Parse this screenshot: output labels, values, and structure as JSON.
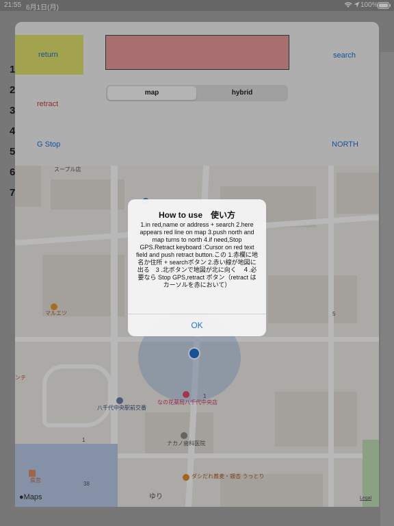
{
  "status": {
    "time": "21:55",
    "date": "6月1日(月)",
    "battery": "100%"
  },
  "background_list": {
    "rows": [
      "1",
      "2",
      "3",
      "4",
      "5",
      "6",
      "7"
    ]
  },
  "toolbar": {
    "return_label": "return",
    "search_label": "search",
    "retract_label": "retract",
    "gstop_label": "G Stop",
    "north_label": "NORTH",
    "search_field_value": "",
    "segments": [
      "map",
      "hybrid"
    ],
    "selected_segment": "map"
  },
  "map": {
    "pois": {
      "maruetsu": "マルエツ",
      "station_koban": "八千代中央駅前交番",
      "pharmacy": "なの花薬局八千代中央店",
      "dental": "ナカノ歯科医院",
      "restaurant": "ダシだれ蕎麦・銀杏 うっとり",
      "top_label": "スープル店",
      "left_label": "ンテ",
      "left_bottom": "県営",
      "road_label": "ゆり",
      "num_1a": "1",
      "num_1b": "1",
      "num_5": "5",
      "num_38": "38"
    },
    "brand": "Maps",
    "legal": "Legal"
  },
  "alert": {
    "title": "How to use　使い方",
    "message": "1.in red,name or address + search 2.here appears red line on map 3.push north and map turns to  north 4.if need,Stop GPS.Retract keyboard :Cursor on red text field and push retract  button.この 1.赤欄に地名か住所 + searchボタン  2.赤い線が地図に出る　3 .北ボタンで地図が北に向く　４.必要なら Stop GPS,retract ボタン（retract はカーソルを赤において）",
    "ok_label": "OK"
  },
  "colors": {
    "accent": "#1a73d6",
    "retract": "#d23b3b",
    "search_field": "#e89a9a",
    "return_highlight": "#e2e26e",
    "user_location": "#1a73d6"
  }
}
